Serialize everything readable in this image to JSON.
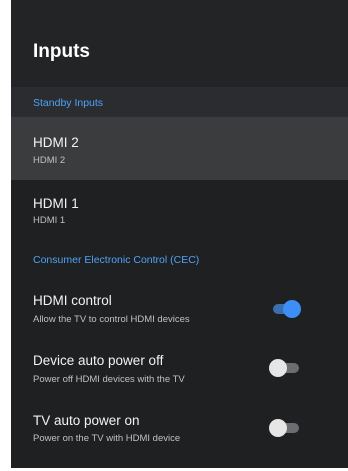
{
  "page": {
    "title": "Inputs"
  },
  "sections": {
    "standby": {
      "label": "Standby Inputs"
    },
    "cec": {
      "label": "Consumer Electronic Control (CEC)"
    }
  },
  "inputs": [
    {
      "title": "HDMI 2",
      "subtitle": "HDMI 2",
      "focused": true
    },
    {
      "title": "HDMI 1",
      "subtitle": "HDMI 1",
      "focused": false
    }
  ],
  "cec_settings": [
    {
      "title": "HDMI control",
      "subtitle": "Allow the TV to control HDMI devices",
      "enabled": true
    },
    {
      "title": "Device auto power off",
      "subtitle": "Power off HDMI devices with the TV",
      "enabled": false
    },
    {
      "title": "TV auto power on",
      "subtitle": "Power on the TV with HDMI device",
      "enabled": false
    }
  ],
  "colors": {
    "panel_background": "#1f2021",
    "focused_row": "#3b3c3e",
    "section_label": "#4fa3f7",
    "toggle_on": "#3d8ff5",
    "toggle_off": "#e6e6e6"
  }
}
